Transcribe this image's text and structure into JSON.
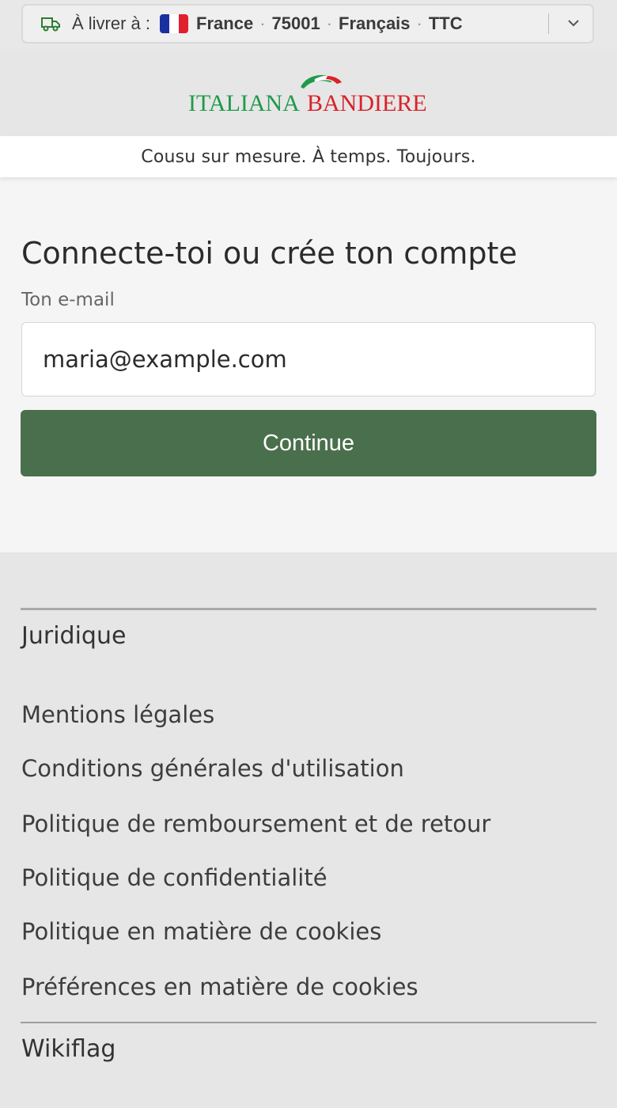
{
  "shipping": {
    "label": "À livrer à :",
    "country": "France",
    "postcode": "75001",
    "language": "Français",
    "tax": "TTC",
    "separator": "·"
  },
  "brand": {
    "name_part1": "ITALIANA",
    "name_part2": "BANDIERE",
    "colors": {
      "green": "#1f9a4a",
      "red": "#d8232a"
    }
  },
  "tagline": "Cousu sur mesure. À temps. Toujours.",
  "login": {
    "title": "Connecte-toi ou crée ton compte",
    "email_label": "Ton e-mail",
    "email_value": "maria@example.com",
    "continue_label": "Continue",
    "button_color": "#4a6f4c"
  },
  "footer": {
    "sections": [
      {
        "title": "Juridique",
        "links": [
          "Mentions légales",
          "Conditions générales d'utilisation",
          "Politique de remboursement et de retour",
          "Politique de confidentialité",
          "Politique en matière de cookies",
          "Préférences en matière de cookies"
        ]
      },
      {
        "title": "Wikiflag"
      }
    ]
  },
  "icons": {
    "truck": "truck-icon",
    "flag": "flag-france-icon",
    "chevron": "chevron-down-icon"
  }
}
